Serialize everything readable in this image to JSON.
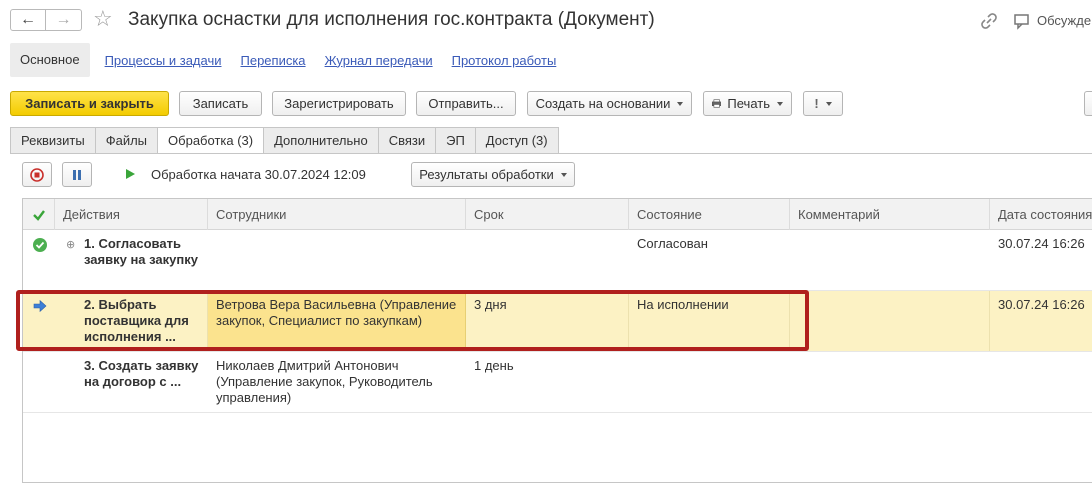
{
  "window": {
    "title": "Закупка оснастки для исполнения гос.контракта (Документ)",
    "discuss_label": "Обсуждение"
  },
  "linkbar": {
    "main": "Основное",
    "links": [
      "Процессы и задачи",
      "Переписка",
      "Журнал передачи",
      "Протокол работы"
    ]
  },
  "toolbar": {
    "save_close": "Записать и закрыть",
    "save": "Записать",
    "register": "Зарегистрировать",
    "send": "Отправить...",
    "create_based": "Создать на основании",
    "print": "Печать",
    "important": "!"
  },
  "tabs": [
    "Реквизиты",
    "Файлы",
    "Обработка (3)",
    "Дополнительно",
    "Связи",
    "ЭП",
    "Доступ (3)"
  ],
  "active_tab": "Обработка (3)",
  "processing": {
    "status": "Обработка начата 30.07.2024 12:09",
    "results_button": "Результаты обработки"
  },
  "table": {
    "columns": [
      "Действия",
      "Сотрудники",
      "Срок",
      "Состояние",
      "Комментарий",
      "Дата состояния"
    ],
    "rows": [
      {
        "action": "1. Согласовать заявку на закупку",
        "employees": "",
        "deadline": "",
        "state": "Согласован",
        "comment": "",
        "state_date": "30.07.24 16:26",
        "icon": "check-circle-icon",
        "selected": false
      },
      {
        "action": "2. Выбрать поставщика для исполнения ...",
        "employees": "Ветрова Вера Васильевна (Управление закупок, Специалист по закупкам)",
        "deadline": "3 дня",
        "state": "На исполнении",
        "comment": "",
        "state_date": "30.07.24 16:26",
        "icon": "arrow-right-icon",
        "selected": true
      },
      {
        "action": "3. Создать заявку на договор с ...",
        "employees": "Николаев Дмитрий Антонович (Управление закупок, Руководитель управления)",
        "deadline": "1 день",
        "state": "",
        "comment": "",
        "state_date": "",
        "icon": "",
        "selected": false
      }
    ]
  },
  "colors": {
    "primary_button": "#f3cc00",
    "selected_row": "#fcf2c4",
    "selected_cell": "#fbe38e",
    "highlight_border": "#b0201d",
    "link": "#3a5ab8"
  }
}
